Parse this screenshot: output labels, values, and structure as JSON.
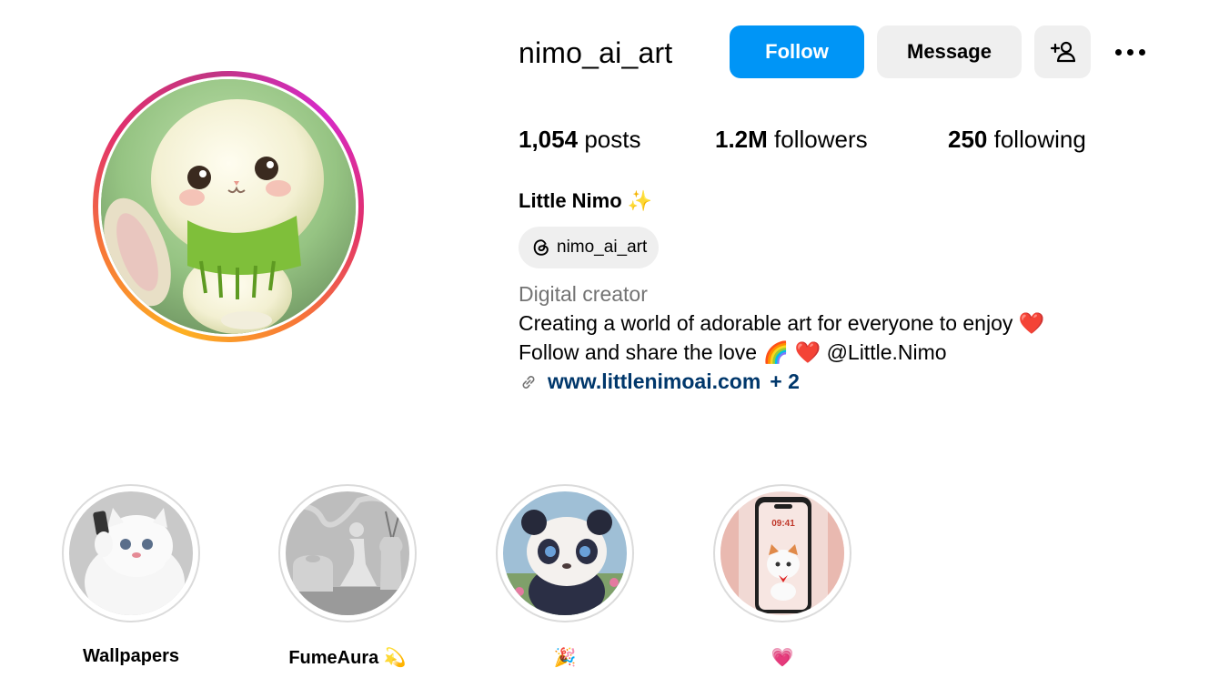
{
  "profile": {
    "username": "nimo_ai_art",
    "follow_label": "Follow",
    "message_label": "Message",
    "stats": {
      "posts_count": "1,054",
      "posts_label": "posts",
      "followers_count": "1.2M",
      "followers_label": "followers",
      "following_count": "250",
      "following_label": "following"
    },
    "full_name": "Little Nimo",
    "full_name_emoji": "✨",
    "threads_handle": "nimo_ai_art",
    "category": "Digital creator",
    "bio_line1": "Creating a world of adorable art for everyone to enjoy",
    "bio_line1_emoji": "❤️",
    "bio_line2": "Follow and share the love",
    "bio_line2_emoji": "🌈 ❤️",
    "bio_line2_mention": "@Little.Nimo",
    "link_text": "www.littlenimoai.com",
    "link_more": "+ 2"
  },
  "highlights": [
    {
      "label": "Wallpapers",
      "emoji": ""
    },
    {
      "label": "FumeAura",
      "emoji": "💫"
    },
    {
      "label": "",
      "emoji": "🎉"
    },
    {
      "label": "",
      "emoji": "💗"
    }
  ],
  "highlight_phone_time": "09:41",
  "colors": {
    "follow_button": "#0095f6",
    "secondary_button": "#efefef",
    "link": "#00376b",
    "muted": "#737373"
  },
  "icons": [
    "add-person-icon",
    "more-options-icon",
    "threads-icon",
    "link-icon"
  ]
}
